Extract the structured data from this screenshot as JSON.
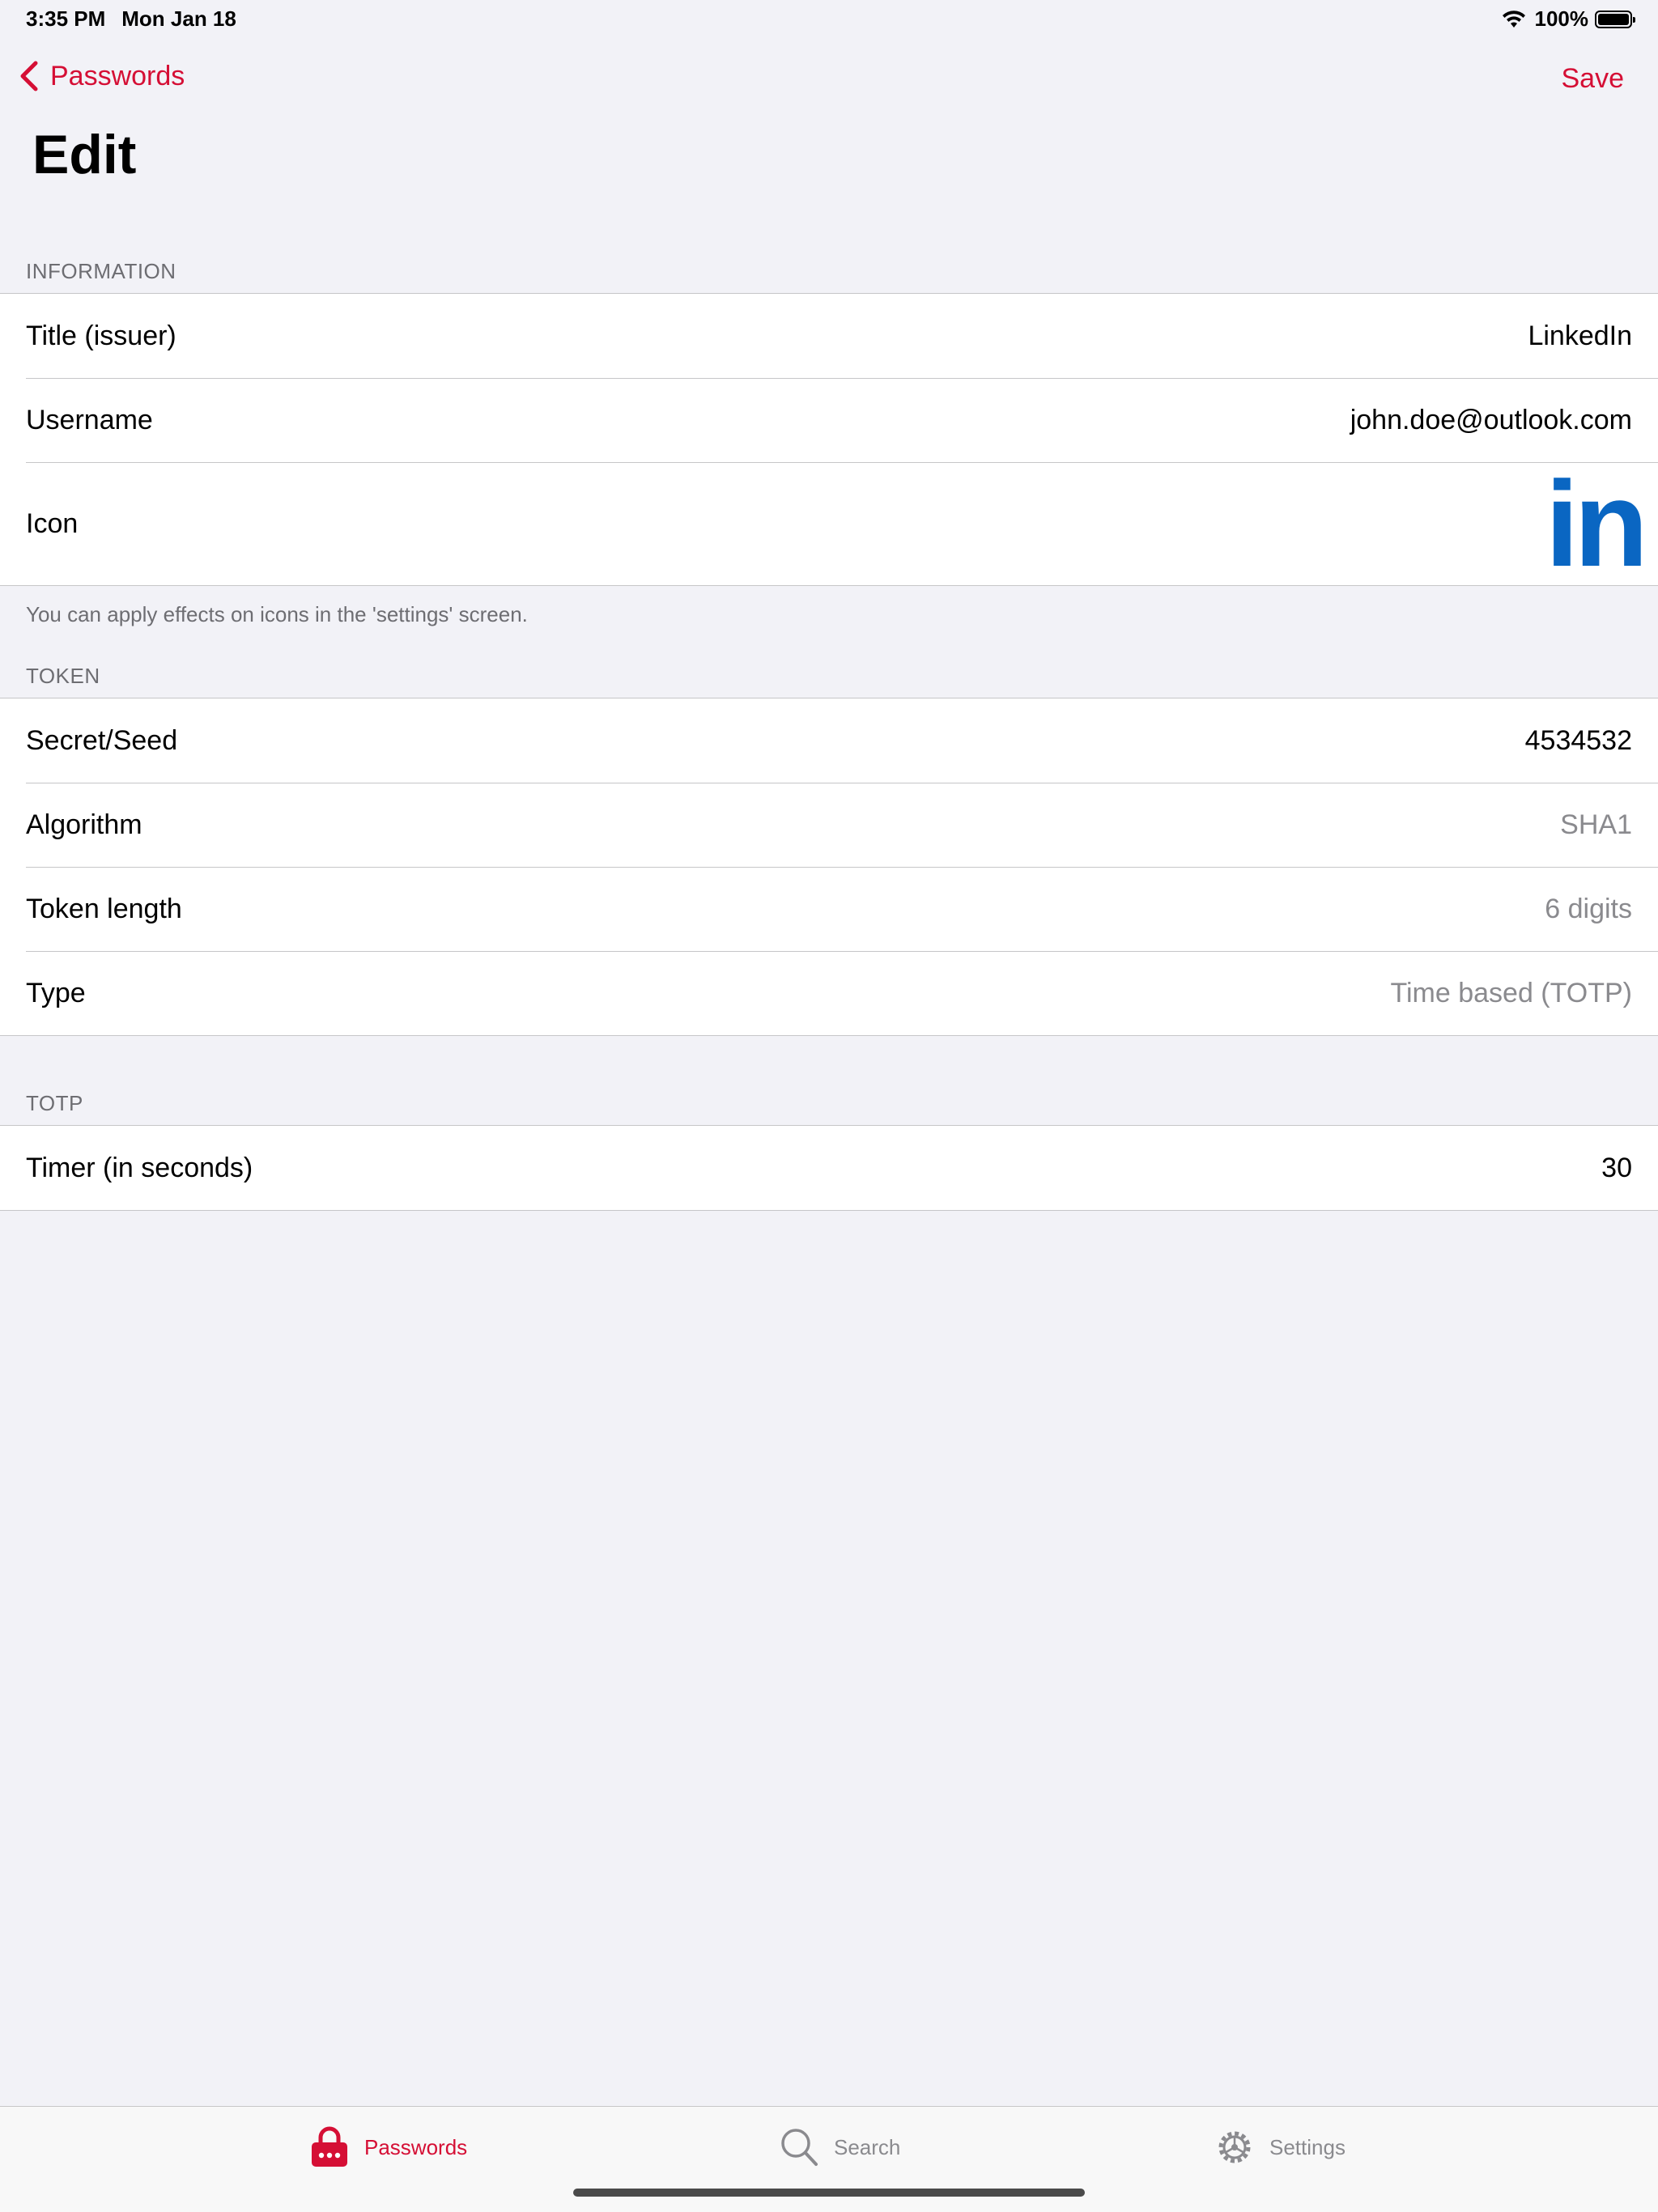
{
  "status_bar": {
    "time": "3:35 PM",
    "date": "Mon Jan 18",
    "battery": "100%"
  },
  "nav": {
    "back_label": "Passwords",
    "save_label": "Save",
    "title": "Edit"
  },
  "sections": {
    "information": {
      "header": "INFORMATION",
      "title_label": "Title (issuer)",
      "title_value": "LinkedIn",
      "username_label": "Username",
      "username_value": "john.doe@outlook.com",
      "icon_label": "Icon",
      "icon_name": "linkedin-logo",
      "icon_text": "in",
      "footer": "You can apply effects on icons in the 'settings' screen."
    },
    "token": {
      "header": "TOKEN",
      "secret_label": "Secret/Seed",
      "secret_value": "4534532",
      "algorithm_label": "Algorithm",
      "algorithm_value": "SHA1",
      "length_label": "Token length",
      "length_value": "6 digits",
      "type_label": "Type",
      "type_value": "Time based (TOTP)"
    },
    "totp": {
      "header": "TOTP",
      "timer_label": "Timer (in seconds)",
      "timer_value": "30"
    }
  },
  "tab_bar": {
    "passwords": "Passwords",
    "search": "Search",
    "settings": "Settings",
    "active": "passwords"
  },
  "colors": {
    "accent": "#d50f35",
    "linkedin": "#0a66c2",
    "background": "#f2f2f7",
    "muted_text": "#8a8a8e"
  }
}
